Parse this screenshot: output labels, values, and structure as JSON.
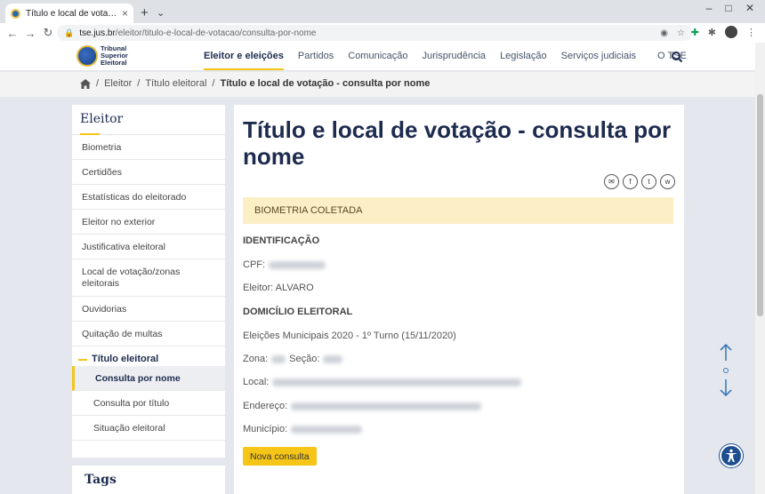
{
  "browser": {
    "tab_title": "Título e local de votação - cons...",
    "tab_close": "×",
    "new_tab": "+",
    "tab_menu": "⌄",
    "win_min": "–",
    "win_max": "□",
    "win_close": "✕",
    "url_host": "tse.jus.br",
    "url_path": "/eleitor/titulo-e-local-de-votacao/consulta-por-nome"
  },
  "header": {
    "logo_line1": "Tribunal",
    "logo_line2": "Superior",
    "logo_line3": "Eleitoral",
    "nav": [
      "Eleitor e eleições",
      "Partidos",
      "Comunicação",
      "Jurisprudência",
      "Legislação",
      "Serviços judiciais",
      "O TSE"
    ]
  },
  "breadcrumb": {
    "sep": "/",
    "items": [
      "Eleitor",
      "Título eleitoral",
      "Título e local de votação - consulta por nome"
    ]
  },
  "sidebar": {
    "title": "Eleitor",
    "items": [
      "Biometria",
      "Certidões",
      "Estatísticas do eleitorado",
      "Eleitor no exterior",
      "Justificativa eleitoral",
      "Local de votação/zonas eleitorais",
      "Ouvidorias",
      "Quitação de multas"
    ],
    "group": "Título eleitoral",
    "subitems": [
      "Consulta por nome",
      "Consulta por título",
      "Situação eleitoral"
    ],
    "tags_title": "Tags"
  },
  "main": {
    "title": "Título e local de votação - consulta por nome",
    "share": [
      "✉",
      "f",
      "t",
      "w"
    ],
    "notice": "BIOMETRIA COLETADA",
    "identificacao": "IDENTIFICAÇÃO",
    "cpf_label": "CPF:",
    "eleitor_label": "Eleitor: ALVARO",
    "domicilio": "DOMICÍLIO ELEITORAL",
    "eleicoes": "Eleições Municipais 2020 - 1º Turno (15/11/2020)",
    "zona_label": "Zona:",
    "secao_label": "Seção:",
    "local_label": "Local:",
    "endereco_label": "Endereço:",
    "municipio_label": "Município:",
    "button": "Nova consulta"
  },
  "colors": {
    "accent": "#f5c518",
    "navy": "#1d2b4f",
    "notice_bg": "#fcefc6"
  }
}
